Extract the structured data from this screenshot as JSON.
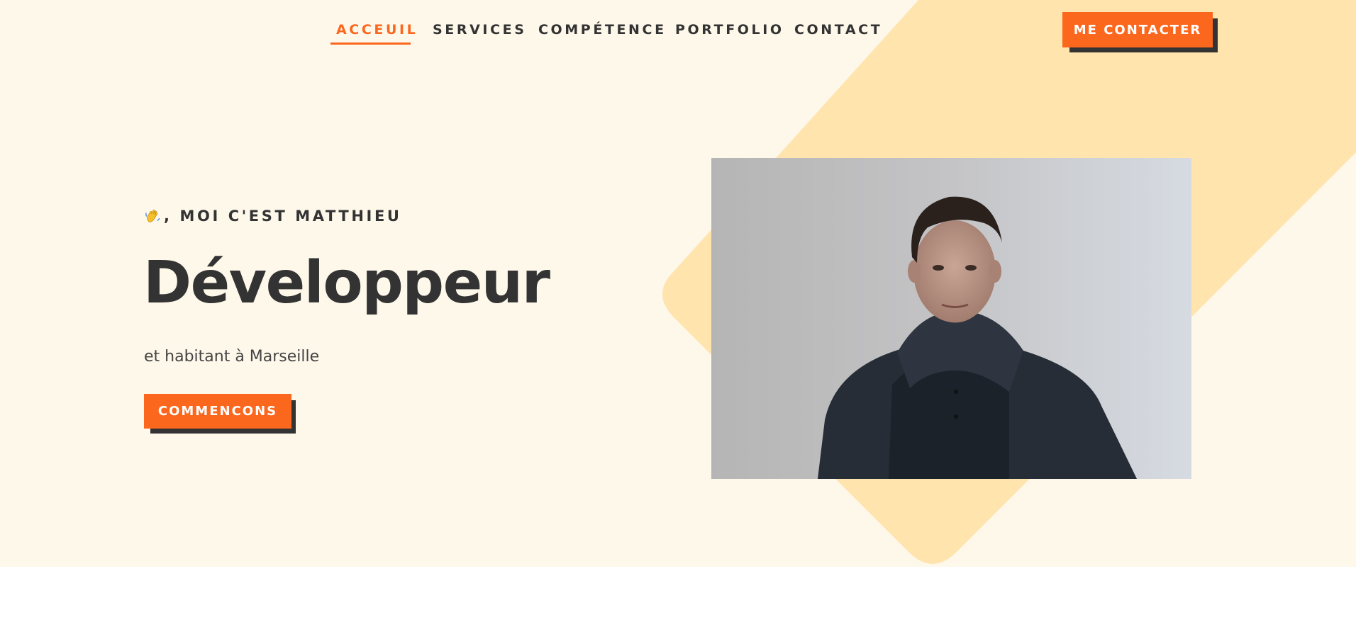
{
  "nav": {
    "links": [
      {
        "label": "ACCEUIL",
        "active": true
      },
      {
        "label": "SERVICES",
        "active": false
      },
      {
        "label": "COMPÉTENCE",
        "active": false
      },
      {
        "label": "PORTFOLIO",
        "active": false
      },
      {
        "label": "CONTACT",
        "active": false
      }
    ],
    "cta_label": "ME CONTACTER"
  },
  "hero": {
    "greeting": ", MOI C'EST MATTHIEU",
    "greeting_icon": "waving-hand-icon",
    "title": "Développeur",
    "subtitle": "et habitant à Marseille",
    "cta_label": "COMMENCONS",
    "photo_icon": "profile-photo"
  },
  "colors": {
    "accent": "#fc671e",
    "dark": "#333333",
    "hero_background": "#fef8ea",
    "shape": "#ffe4ae",
    "page_background": "#ffffff"
  }
}
